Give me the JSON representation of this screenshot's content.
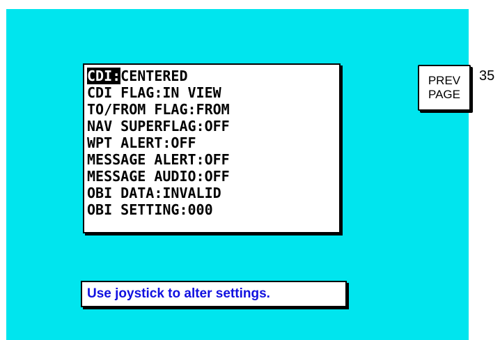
{
  "settings": [
    {
      "key": "CDI:",
      "value": "CENTERED",
      "selected": true
    },
    {
      "key": "CDI FLAG:",
      "value": "IN VIEW"
    },
    {
      "key": "TO/FROM FLAG:",
      "value": "FROM"
    },
    {
      "key": "NAV SUPERFLAG:",
      "value": "OFF"
    },
    {
      "key": "WPT ALERT:",
      "value": "OFF"
    },
    {
      "key": "MESSAGE ALERT:",
      "value": "OFF"
    },
    {
      "key": "MESSAGE AUDIO:",
      "value": "OFF"
    },
    {
      "key": "OBI DATA:",
      "value": "INVALID"
    },
    {
      "key": "OBI SETTING:",
      "value": "000"
    }
  ],
  "prev_page": {
    "line1": "PREV",
    "line2": "PAGE"
  },
  "page_number": "35",
  "hint": "Use joystick to alter settings.",
  "colors": {
    "background": "#00e5ee",
    "hint_text": "#1010e0"
  }
}
